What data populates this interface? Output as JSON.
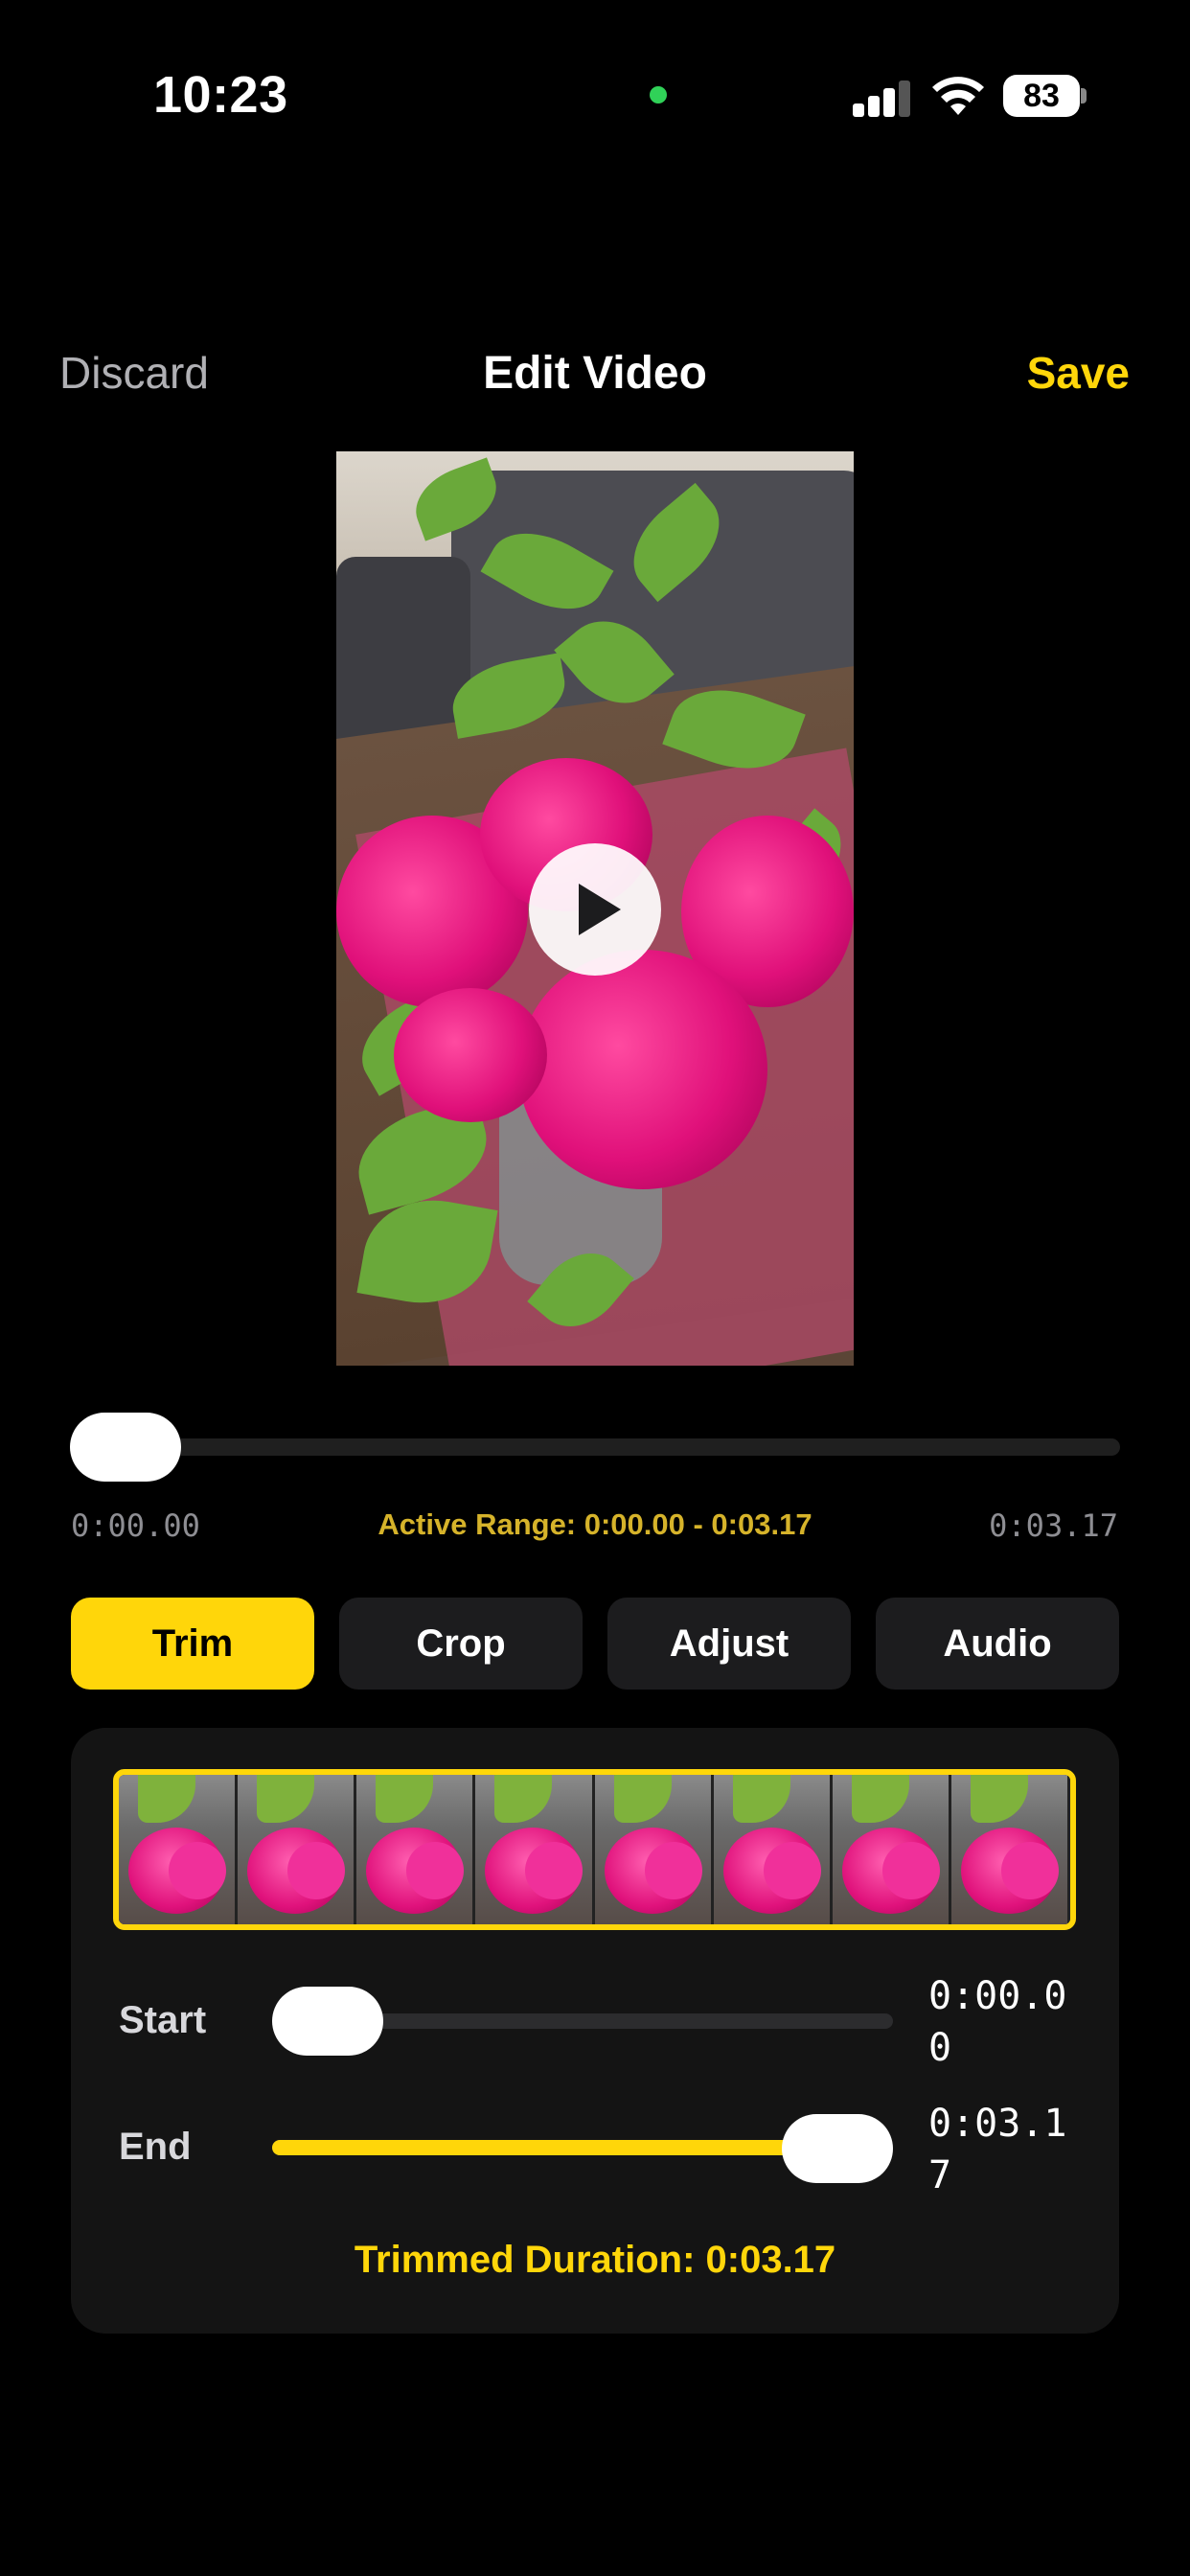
{
  "status_bar": {
    "time": "10:23",
    "battery": "83"
  },
  "nav": {
    "discard_label": "Discard",
    "title": "Edit Video",
    "save_label": "Save"
  },
  "playback": {
    "start_time": "0:00.00",
    "active_range": "Active Range: 0:00.00 - 0:03.17",
    "end_time": "0:03.17",
    "position_fraction": 0.0
  },
  "tabs": [
    {
      "label": "Trim",
      "active": true
    },
    {
      "label": "Crop",
      "active": false
    },
    {
      "label": "Adjust",
      "active": false
    },
    {
      "label": "Audio",
      "active": false
    }
  ],
  "trim": {
    "filmstrip_frame_count": 8,
    "start": {
      "label": "Start",
      "value": "0:00.00",
      "fraction": 0.0
    },
    "end": {
      "label": "End",
      "value": "0:03.17",
      "fraction": 1.0
    },
    "trimmed_duration": "Trimmed Duration: 0:03.17"
  },
  "icons": {
    "play": "play-icon",
    "signal": "cellular-signal-icon",
    "wifi": "wifi-icon",
    "battery": "battery-icon",
    "camera_indicator": "camera-in-use-indicator"
  },
  "colors": {
    "accent": "#ffd60a",
    "background": "#000000",
    "panel": "#141414",
    "camera_dot": "#30d158"
  }
}
